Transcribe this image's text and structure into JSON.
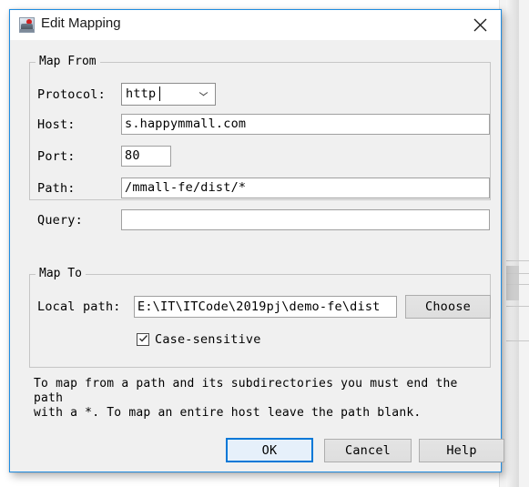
{
  "window": {
    "title": "Edit Mapping",
    "icon": "app-icon",
    "close_label": "✕",
    "accent_color": "#1f8ce0",
    "body_color": "#f0f0f0",
    "titlebar_color": "#ffffff"
  },
  "map_from": {
    "legend": "Map From",
    "fields": [
      {
        "label": "Protocol:",
        "value": "http",
        "kind": "combobox"
      },
      {
        "label": "Host:",
        "value": "s.happymmall.com",
        "kind": "textbox"
      },
      {
        "label": "Port:",
        "value": "80",
        "kind": "textbox"
      },
      {
        "label": "Path:",
        "value": "/mmall-fe/dist/*",
        "kind": "textbox"
      },
      {
        "label": "Query:",
        "value": "",
        "kind": "textbox"
      }
    ]
  },
  "map_to": {
    "legend": "Map To",
    "local_path_label": "Local path:",
    "local_path_value": "E:\\IT\\ITCode\\2019pj\\demo-fe\\dist",
    "choose_label": "Choose",
    "case_sensitive_label": "Case-sensitive",
    "case_sensitive_checked": true
  },
  "help_text": "To map from a path and its subdirectories you must end the path\nwith a *. To map an entire host leave the path blank.",
  "buttons": {
    "ok": "OK",
    "cancel": "Cancel",
    "help": "Help"
  }
}
